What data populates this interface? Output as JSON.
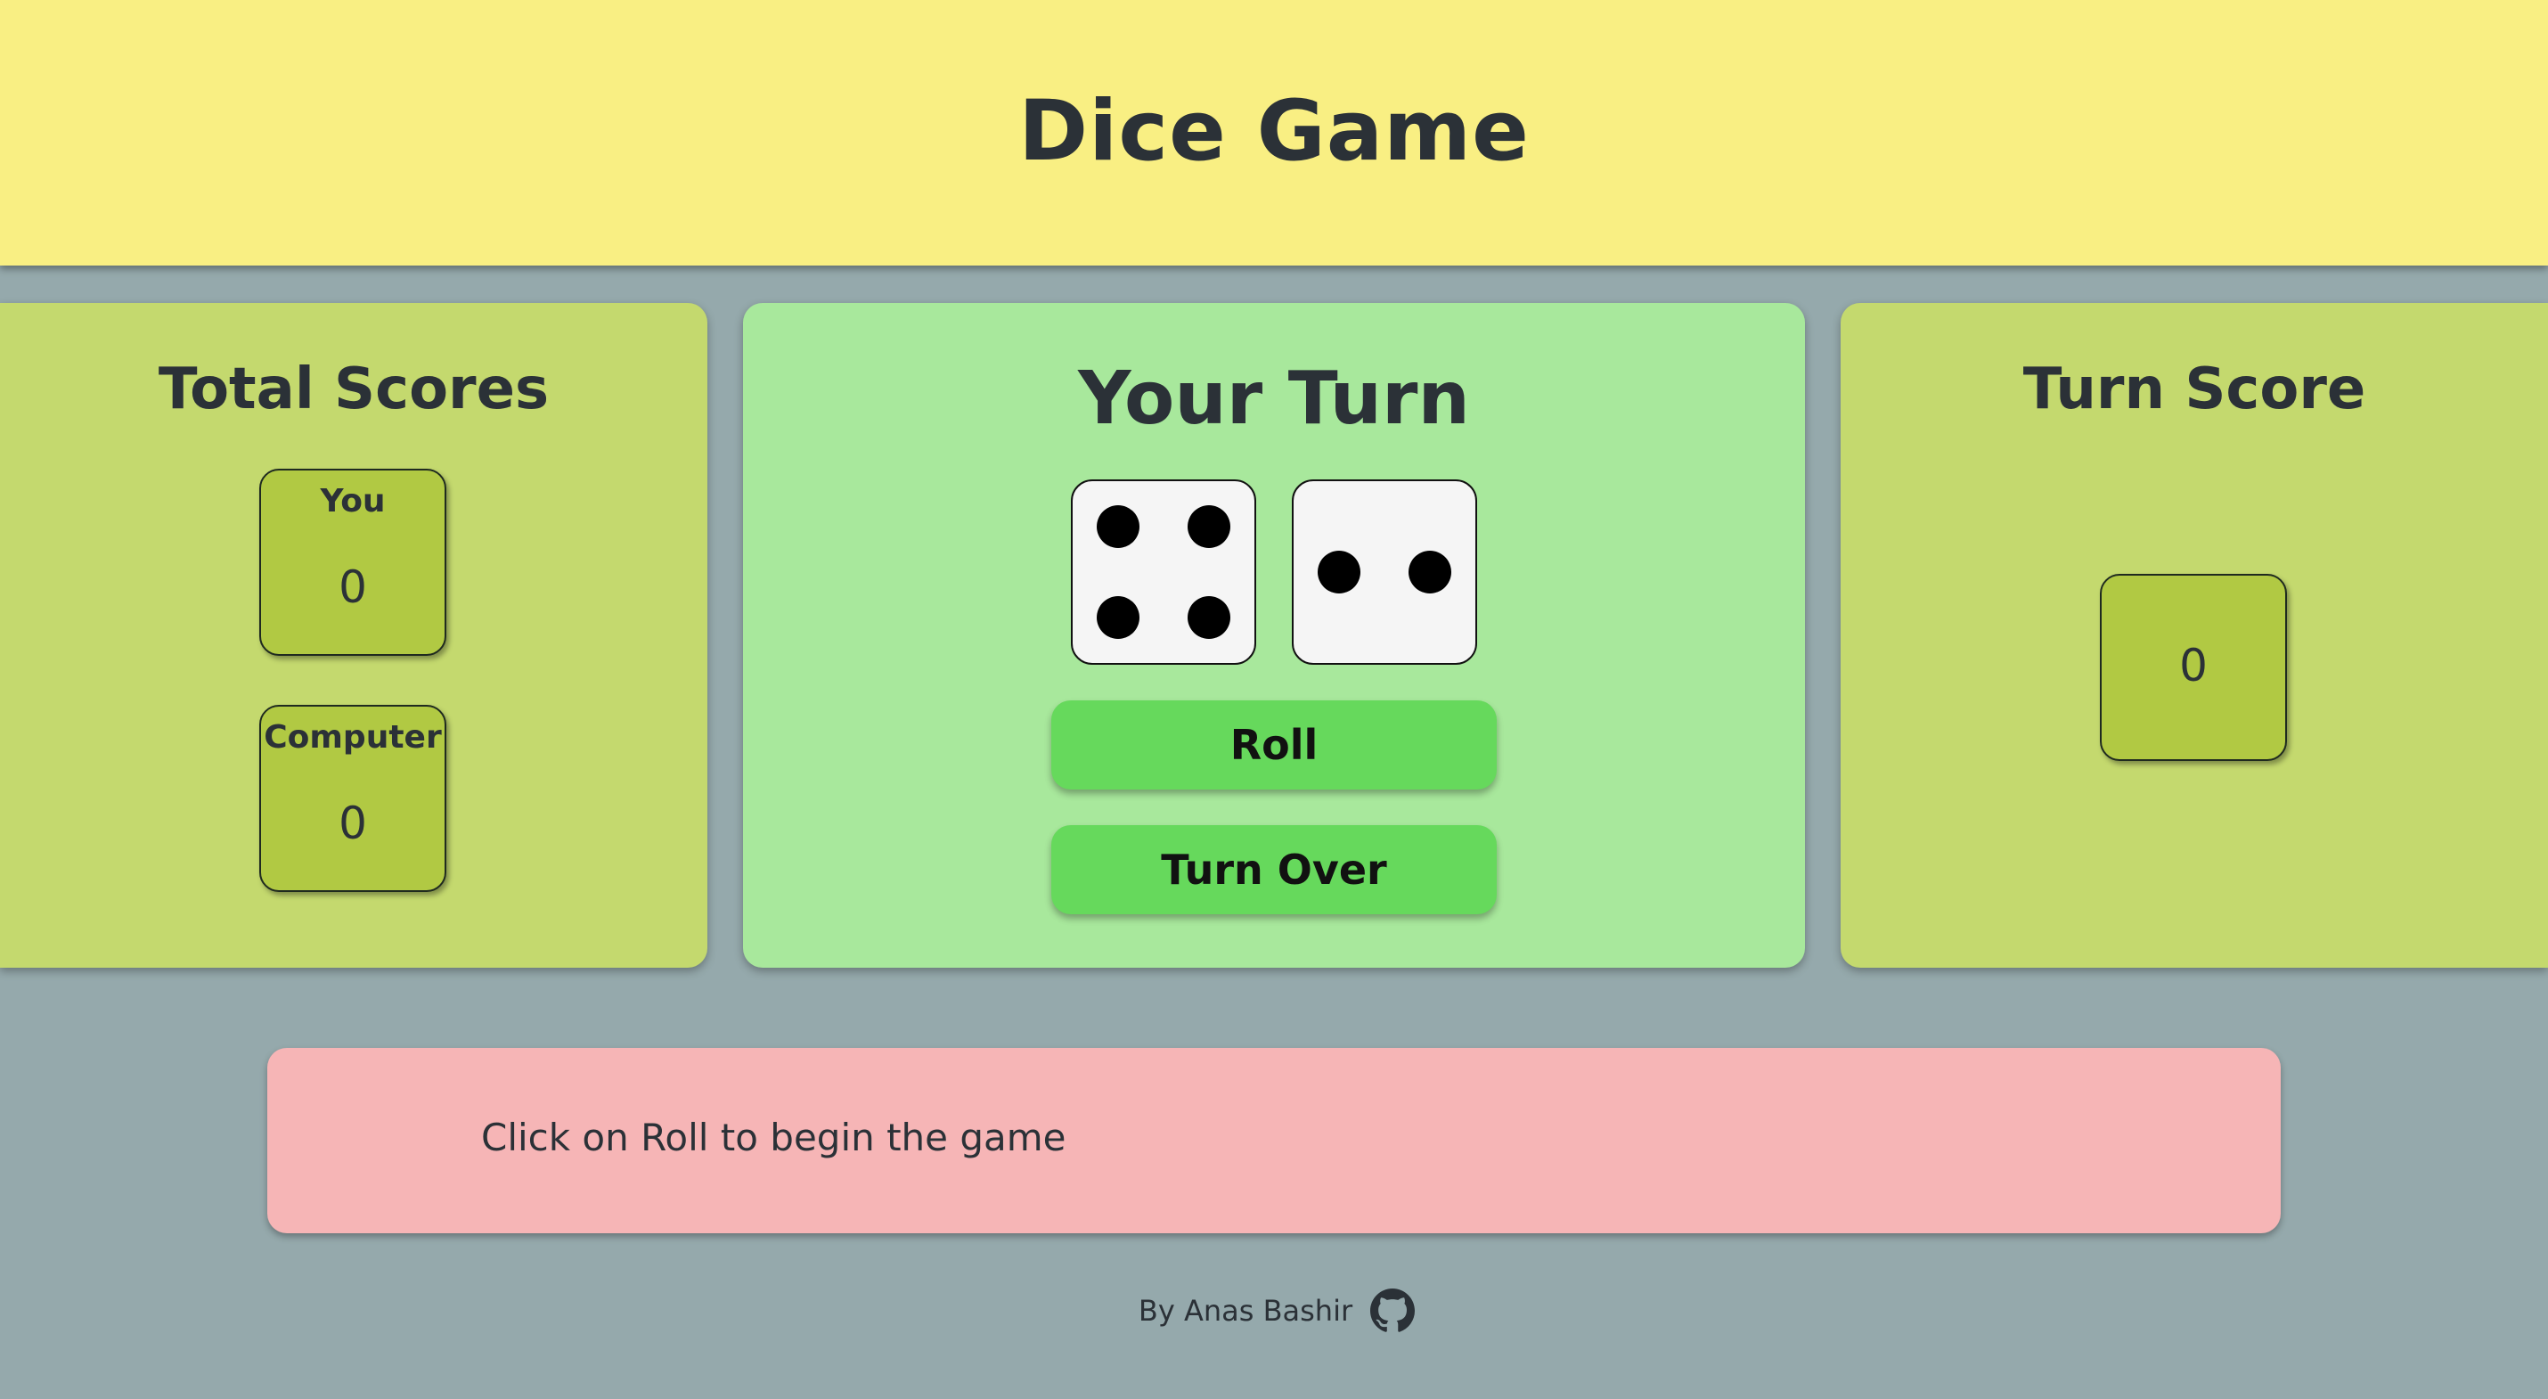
{
  "header": {
    "title": "Dice Game"
  },
  "total_scores": {
    "title": "Total Scores",
    "players": [
      {
        "label": "You",
        "score": "0"
      },
      {
        "label": "Computer",
        "score": "0"
      }
    ]
  },
  "turn_panel": {
    "title": "Your Turn",
    "dice": [
      4,
      2
    ],
    "roll_label": "Roll",
    "turn_over_label": "Turn Over"
  },
  "turn_score": {
    "title": "Turn Score",
    "value": "0"
  },
  "message": {
    "text": "Click on Roll to begin the game"
  },
  "footer": {
    "credit": "By Anas Bashir",
    "icon": "github-icon"
  },
  "colors": {
    "background": "#95a9ac",
    "header": "#f9ef83",
    "side_panel": "#c4d96e",
    "center_panel": "#a8e89c",
    "score_box": "#b1c943",
    "button": "#66d95c",
    "message": "#f6b5b6"
  }
}
